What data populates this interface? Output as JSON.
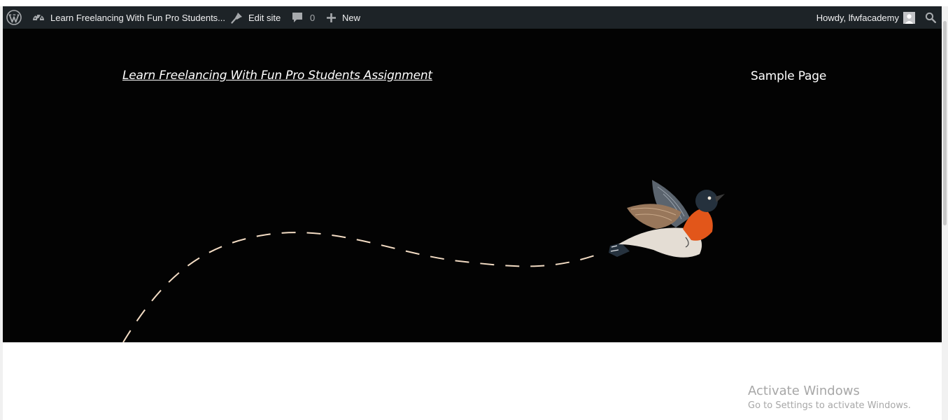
{
  "admin_bar": {
    "site_name": "Learn Freelancing With Fun Pro Students...",
    "edit_site": "Edit site",
    "comments_count": "0",
    "new_label": "New",
    "howdy": "Howdy, lfwfacademy"
  },
  "header": {
    "site_title": "Learn Freelancing With Fun Pro Students Assignment",
    "nav": [
      "Sample Page"
    ]
  },
  "activation_watermark": {
    "title": "Activate Windows",
    "subtitle": "Go to Settings to activate Windows."
  },
  "colors": {
    "admin_bar_bg": "#1d2327",
    "hero_bg": "#030303",
    "dash_path": "#f3dcc4",
    "bird_breast": "#e2561a",
    "bird_head": "#25313d"
  },
  "icons": [
    "wordpress-logo-icon",
    "dashboard-icon",
    "edit-brush-icon",
    "comment-icon",
    "plus-icon",
    "avatar-icon",
    "search-icon"
  ]
}
